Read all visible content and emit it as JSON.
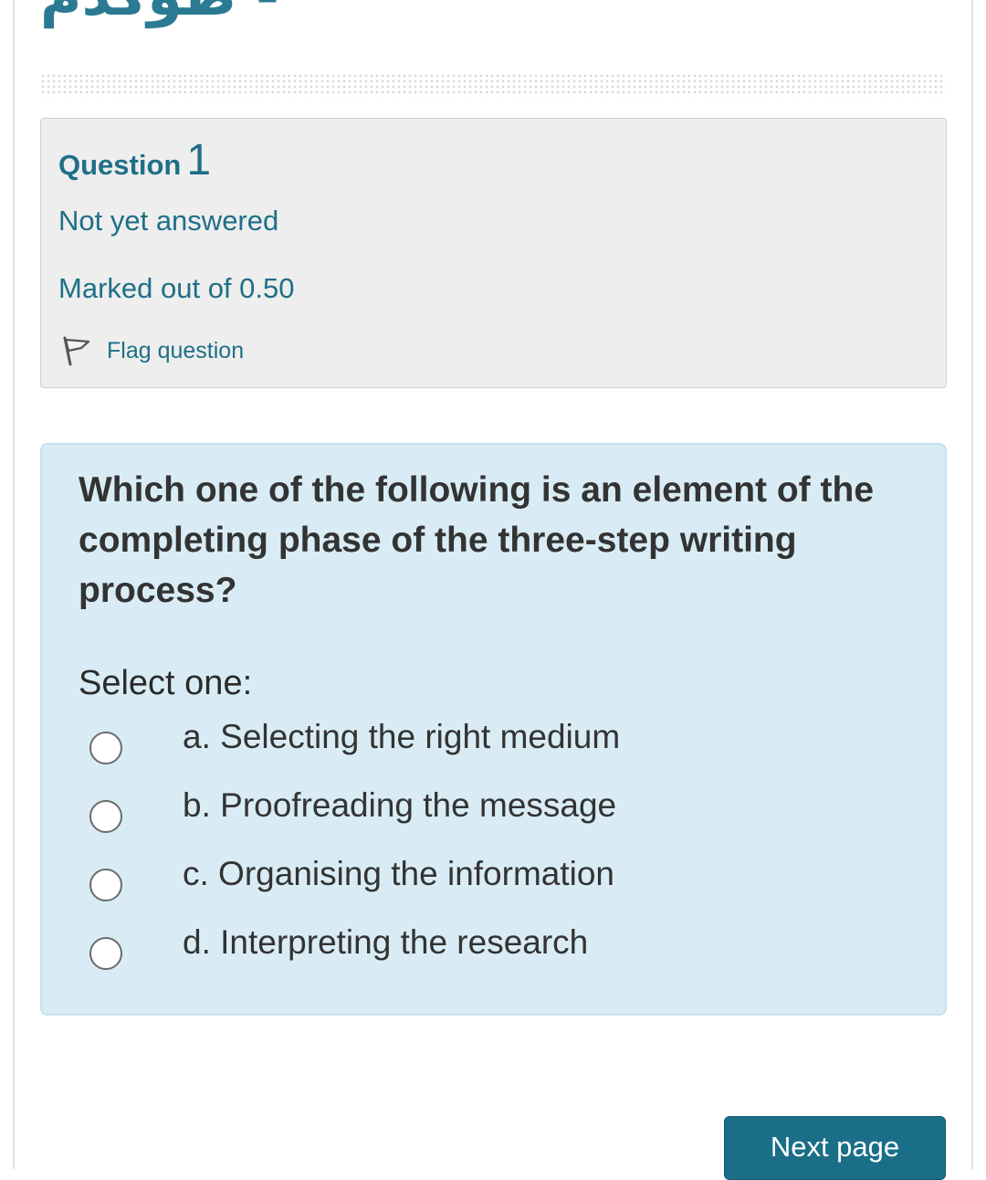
{
  "header": {
    "title": "- طوكدم"
  },
  "question_info": {
    "label": "Question",
    "number": "1",
    "state": "Not yet answered",
    "grade": "Marked out of 0.50",
    "flag_label": "Flag question"
  },
  "question": {
    "text": "Which one of the following is an element of the completing phase of the three-step writing process?",
    "prompt": "Select one:",
    "options": [
      {
        "label": "a. Selecting the right medium"
      },
      {
        "label": "b. Proofreading the message"
      },
      {
        "label": "c. Organising the information"
      },
      {
        "label": "d. Interpreting the research"
      }
    ]
  },
  "navigation": {
    "next_label": "Next page"
  },
  "colors": {
    "accent": "#1f6f87",
    "info_bg": "#eeeeee",
    "content_bg": "#d9ecf5",
    "button_bg": "#1a6e87"
  }
}
